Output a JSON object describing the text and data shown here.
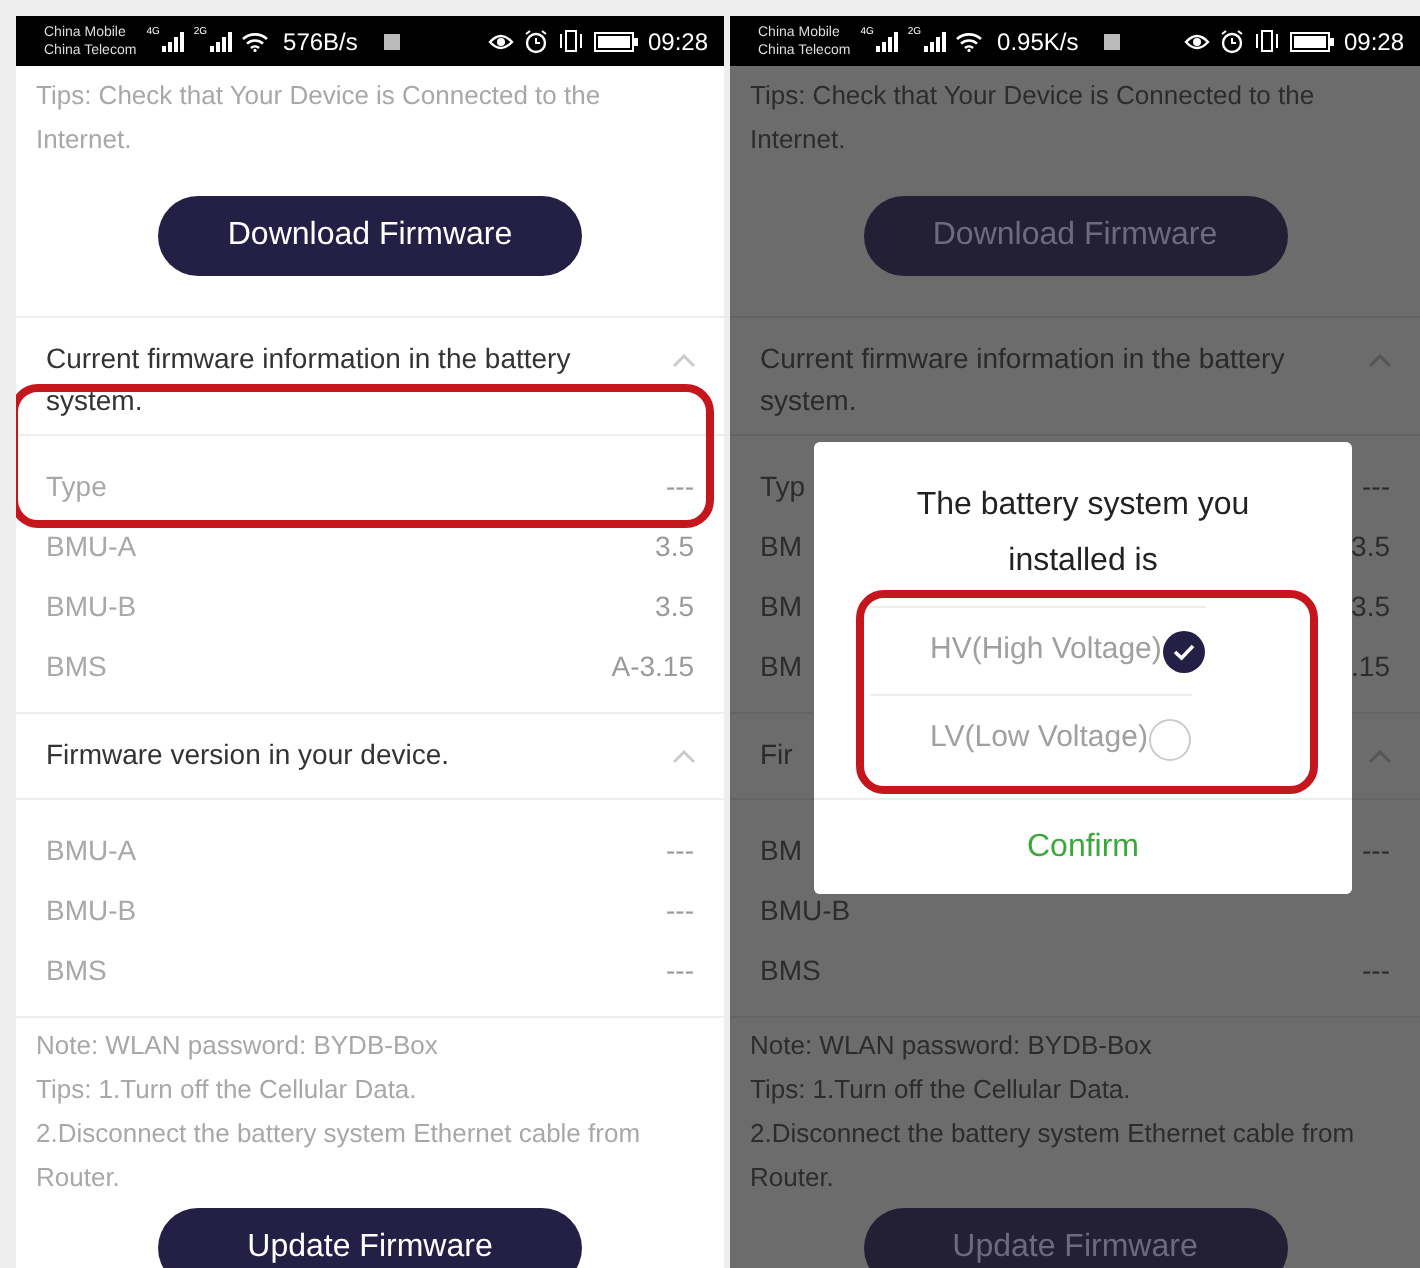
{
  "screens": [
    {
      "dimmed": false,
      "status_bar": {
        "carrier": [
          "China Mobile",
          "China Telecom"
        ],
        "network_labels": [
          "4G",
          "2G"
        ],
        "speed": "576B/s",
        "time": "09:28"
      },
      "tips": "Tips: Check that Your Device is Connected to the Internet.",
      "download_button": "Download Firmware",
      "sections": [
        {
          "title": "Current firmware information in the battery system.",
          "expanded": true,
          "rows": [
            {
              "label": "Type",
              "value": "---",
              "highlighted": true
            },
            {
              "label": "BMU-A",
              "value": "3.5",
              "highlighted": false
            },
            {
              "label": "BMU-B",
              "value": "3.5",
              "highlighted": false
            },
            {
              "label": "BMS",
              "value": "A-3.15",
              "highlighted": false
            }
          ]
        },
        {
          "title": "Firmware version in your device.",
          "expanded": true,
          "rows": [
            {
              "label": "BMU-A",
              "value": "---",
              "highlighted": false
            },
            {
              "label": "BMU-B",
              "value": "---",
              "highlighted": false
            },
            {
              "label": "BMS",
              "value": "---",
              "highlighted": false
            }
          ]
        }
      ],
      "notes": [
        "Note: WLAN password: BYDB-Box",
        "Tips: 1.Turn off the Cellular Data.",
        "2.Disconnect the battery system Ethernet cable from Router."
      ],
      "update_button": "Update Firmware"
    },
    {
      "dimmed": true,
      "status_bar": {
        "carrier": [
          "China Mobile",
          "China Telecom"
        ],
        "network_labels": [
          "4G",
          "2G"
        ],
        "speed": "0.95K/s",
        "time": "09:28"
      },
      "tips": "Tips: Check that Your Device is Connected to the Internet.",
      "download_button": "Download Firmware",
      "sections": [
        {
          "title": "Current firmware information in the battery system.",
          "expanded": true,
          "rows": [
            {
              "label": "Typ",
              "value": "---",
              "highlighted": false
            },
            {
              "label": "BM",
              "value": "3.5",
              "highlighted": false
            },
            {
              "label": "BM",
              "value": "3.5",
              "highlighted": false
            },
            {
              "label": "BM",
              "value": ".15",
              "highlighted": false
            }
          ]
        },
        {
          "title": "Fir",
          "expanded": true,
          "rows": [
            {
              "label": "BM",
              "value": "---",
              "highlighted": false
            },
            {
              "label": "BMU-B",
              "value": "",
              "highlighted": false
            },
            {
              "label": "BMS",
              "value": "---",
              "highlighted": false
            }
          ]
        }
      ],
      "notes": [
        "Note: WLAN password: BYDB-Box",
        "Tips: 1.Turn off the Cellular Data.",
        "2.Disconnect the battery system Ethernet cable from Router."
      ],
      "update_button": "Update Firmware",
      "dialog": {
        "title": "The battery system you installed is",
        "options": [
          {
            "label": "HV(High Voltage)",
            "selected": true
          },
          {
            "label": "LV(Low Voltage)",
            "selected": false
          }
        ],
        "options_highlighted": true,
        "confirm": "Confirm"
      }
    }
  ]
}
